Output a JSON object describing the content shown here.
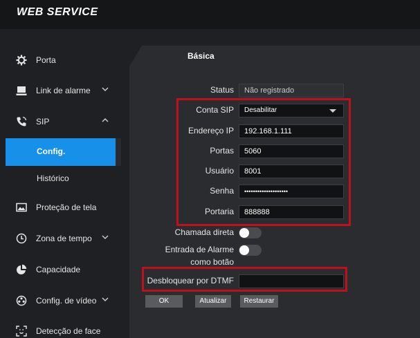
{
  "app": {
    "title": "WEB SERVICE"
  },
  "sidebar": {
    "items": [
      {
        "label": "Porta",
        "icon": "gear-icon"
      },
      {
        "label": "Link de alarme",
        "icon": "alarm-link-icon"
      },
      {
        "label": "SIP",
        "icon": "phone-icon"
      },
      {
        "label": "Proteção de tela",
        "icon": "image-icon"
      },
      {
        "label": "Zona de tempo",
        "icon": "clock-icon"
      },
      {
        "label": "Capacidade",
        "icon": "pie-chart-icon"
      },
      {
        "label": "Config. de vídeo",
        "icon": "video-settings-icon"
      },
      {
        "label": "Detecção de face",
        "icon": "face-detect-icon"
      }
    ],
    "sip_sub": [
      {
        "label": "Config."
      },
      {
        "label": "Histórico"
      }
    ]
  },
  "tab": {
    "label": "Básica"
  },
  "form": {
    "status_label": "Status",
    "status_value": "Não registrado",
    "account_label": "Conta SIP",
    "account_value": "Desabilitar",
    "ip_label": "Endereço IP",
    "ip_value": "192.168.1.111",
    "port_label": "Portas",
    "port_value": "5060",
    "user_label": "Usuário",
    "user_value": "8001",
    "pass_label": "Senha",
    "pass_value": "••••••••••••••••••••",
    "gatekeeper_label": "Portaria",
    "gatekeeper_value": "888888",
    "direct_call_label": "Chamada direta",
    "alarm_input_label_1": "Entrada de Alarme",
    "alarm_input_label_2": "como botão",
    "dtmf_label": "Desbloquear por DTMF",
    "dtmf_value": ""
  },
  "buttons": {
    "ok": "OK",
    "refresh": "Atualizar",
    "restore": "Restaurar"
  },
  "colors": {
    "accent": "#1690e8",
    "highlight": "#c0101e",
    "background": "#1f2023"
  }
}
